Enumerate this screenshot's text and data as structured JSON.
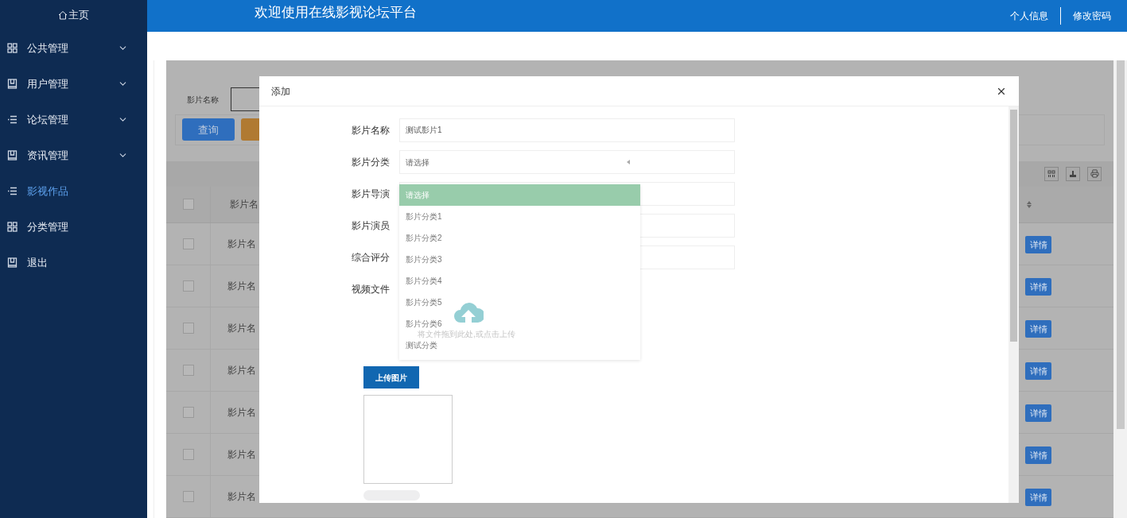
{
  "sidebar": {
    "home": "主页",
    "items": [
      {
        "label": "公共管理",
        "kind": "grid",
        "expandable": true,
        "selected": false
      },
      {
        "label": "用户管理",
        "kind": "book",
        "expandable": true,
        "selected": false
      },
      {
        "label": "论坛管理",
        "kind": "list",
        "expandable": true,
        "selected": false
      },
      {
        "label": "资讯管理",
        "kind": "book",
        "expandable": true,
        "selected": false
      },
      {
        "label": "影视作品",
        "kind": "list",
        "expandable": false,
        "selected": true
      },
      {
        "label": "分类管理",
        "kind": "grid",
        "expandable": false,
        "selected": false
      },
      {
        "label": "退出",
        "kind": "book",
        "expandable": false,
        "selected": false
      }
    ]
  },
  "header": {
    "title": "欢迎使用在线影视论坛平台",
    "links": [
      "个人信息",
      "修改密码"
    ]
  },
  "search": {
    "label": "影片名称",
    "button": "查询"
  },
  "table": {
    "column_2": "影片名",
    "all_checked": false,
    "rows": [
      {
        "column_2": "影片名",
        "action": "详情",
        "checked": false
      },
      {
        "column_2": "影片名",
        "action": "详情",
        "checked": false
      },
      {
        "column_2": "影片名",
        "action": "详情",
        "checked": false
      },
      {
        "column_2": "影片名",
        "action": "详情",
        "checked": false
      },
      {
        "column_2": "影片名",
        "action": "详情",
        "checked": false
      },
      {
        "column_2": "影片名",
        "action": "详情",
        "checked": false
      },
      {
        "column_2": "影片名",
        "action": "详情",
        "checked": false
      }
    ]
  },
  "modal": {
    "title": "添加",
    "fields": [
      {
        "label": "影片名称",
        "kind": "text",
        "value": "测试影片1"
      },
      {
        "label": "影片分类",
        "kind": "select",
        "placeholder": "请选择"
      },
      {
        "label": "影片导演",
        "kind": "text"
      },
      {
        "label": "影片演员",
        "kind": "text"
      },
      {
        "label": "综合评分",
        "kind": "text"
      },
      {
        "label": "视频文件",
        "kind": "upload",
        "hint": "将文件拖到此处,或点击上传"
      }
    ],
    "dropdown": [
      {
        "label": "请选择",
        "selected": true
      },
      {
        "label": "影片分类1",
        "selected": false
      },
      {
        "label": "影片分类2",
        "selected": false
      },
      {
        "label": "影片分类3",
        "selected": false
      },
      {
        "label": "影片分类4",
        "selected": false
      },
      {
        "label": "影片分类5",
        "selected": false
      },
      {
        "label": "影片分类6",
        "selected": false
      },
      {
        "label": "测试分类",
        "selected": false
      }
    ],
    "upload_button": "上传图片",
    "upload_progress": {
      "level": 0
    }
  }
}
